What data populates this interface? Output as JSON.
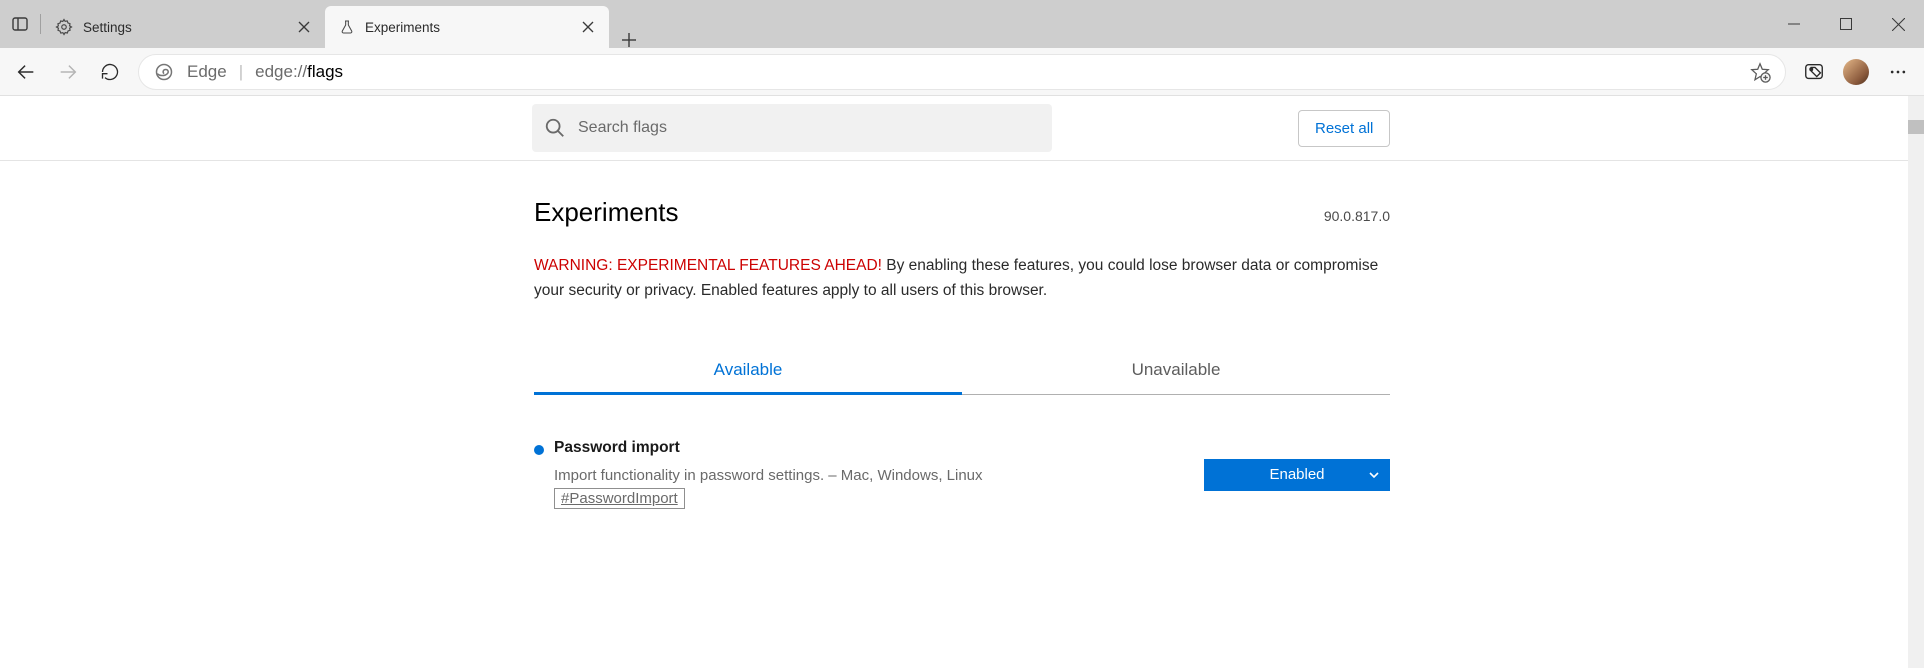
{
  "tabs": [
    {
      "title": "Settings"
    },
    {
      "title": "Experiments"
    }
  ],
  "addressbar": {
    "product_label": "Edge",
    "url_prefix": "edge://",
    "url_path": "flags"
  },
  "search": {
    "placeholder": "Search flags"
  },
  "actions": {
    "reset_label": "Reset all"
  },
  "header": {
    "title": "Experiments",
    "version": "90.0.817.0"
  },
  "warning": {
    "headline": "WARNING: EXPERIMENTAL FEATURES AHEAD!",
    "body": " By enabling these features, you could lose browser data or compromise your security or privacy. Enabled features apply to all users of this browser."
  },
  "flag_tabs": {
    "available": "Available",
    "unavailable": "Unavailable"
  },
  "flag_item": {
    "title": "Password import",
    "description": "Import functionality in password settings. – Mac, Windows, Linux",
    "anchor": "#PasswordImport",
    "selected": "Enabled"
  }
}
